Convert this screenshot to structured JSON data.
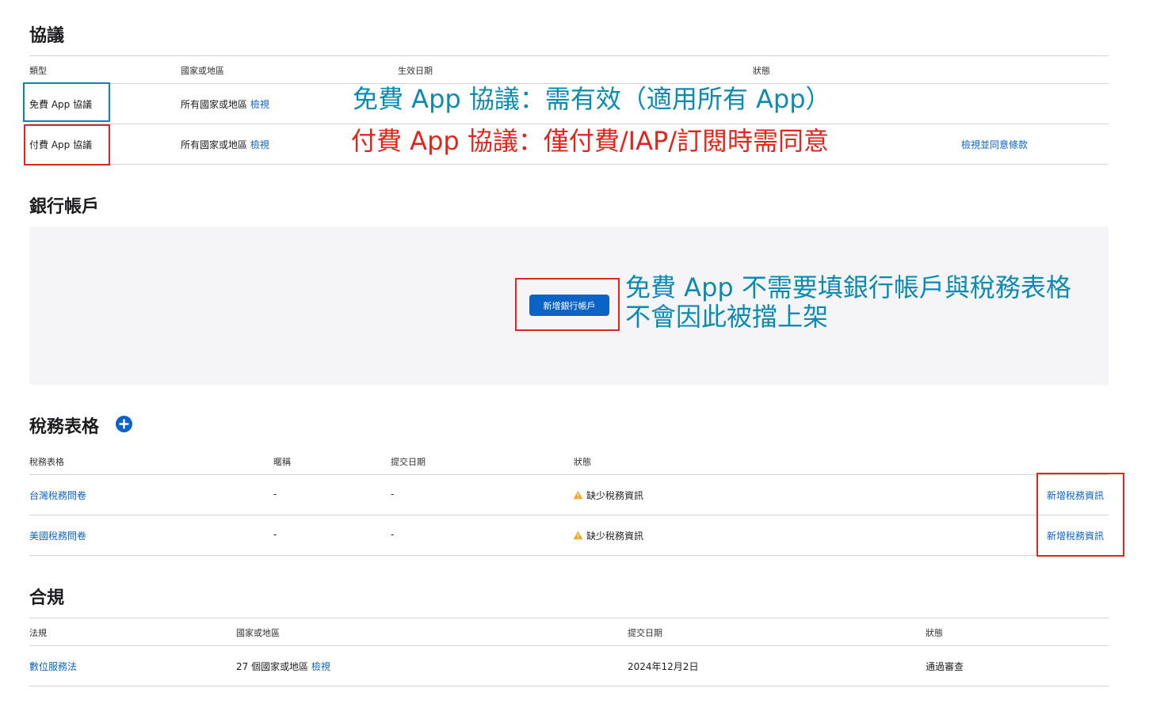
{
  "colors": {
    "link": "#0b63c6",
    "annotation_blue": "#0b8bb0",
    "annotation_red": "#e0261c",
    "box_blue": "#0b84b5",
    "box_red": "#e0261c",
    "warning": "#f5a623"
  },
  "agreements": {
    "title": "協議",
    "headers": [
      "類型",
      "國家或地區",
      "生效日期",
      "狀態"
    ],
    "rows": [
      {
        "type": "免費 App 協議",
        "region": "所有國家或地區",
        "view": "檢視",
        "action": ""
      },
      {
        "type": "付費 App 協議",
        "region": "所有國家或地區",
        "view": "檢視",
        "action": "檢視並同意條款"
      }
    ],
    "annotations": [
      "免費 App 協議：需有效（適用所有 App）",
      "付費 App 協議：僅付費/IAP/訂閱時需同意"
    ]
  },
  "bank": {
    "title": "銀行帳戶",
    "button": "新增銀行帳戶",
    "annotation_line1": "免費 App 不需要填銀行帳戶與稅務表格",
    "annotation_line2": "不會因此被擋上架"
  },
  "tax": {
    "title": "稅務表格",
    "add_icon": "plus-circle-icon",
    "headers": [
      "稅務表格",
      "暱稱",
      "提交日期",
      "狀態"
    ],
    "rows": [
      {
        "form": "台灣稅務問卷",
        "nickname": "-",
        "date": "-",
        "status": "缺少稅務資訊",
        "action": "新增稅務資訊"
      },
      {
        "form": "美國稅務問卷",
        "nickname": "-",
        "date": "-",
        "status": "缺少稅務資訊",
        "action": "新增稅務資訊"
      }
    ]
  },
  "compliance": {
    "title": "合規",
    "headers": [
      "法規",
      "國家或地區",
      "提交日期",
      "狀態"
    ],
    "rows": [
      {
        "law": "數位服務法",
        "region": "27 個國家或地區",
        "view": "檢視",
        "date": "2024年12月2日",
        "status": "通過審查"
      }
    ]
  }
}
